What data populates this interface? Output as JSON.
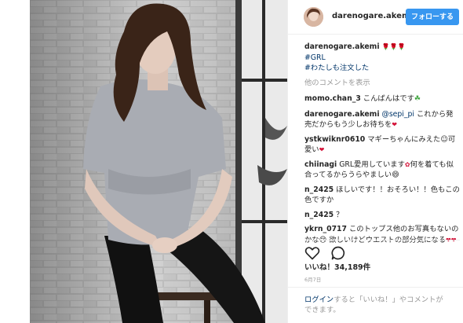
{
  "post": {
    "username": "darenogare.akemi",
    "follow_label": "フォローする"
  },
  "caption": {
    "username": "darenogare.akemi",
    "flowers": "🌹🌹🌹",
    "tag1": "#GRL",
    "tag2": "#わたしも注文した"
  },
  "more_comments": "他のコメントを表示",
  "comments": [
    {
      "user": "momo.chan_3",
      "text": "こんばんはです",
      "emoji": "☘"
    },
    {
      "user": "darenogare.akemi",
      "mention": "@sepi_pi",
      "text": "これから発売だからもう少しお待ちを",
      "emoji": "❤"
    },
    {
      "user": "ystkwiknr0610",
      "text": "マギーちゃんにみえた☺可愛い",
      "emoji": "❤"
    },
    {
      "user": "chiinagi",
      "text": "GRL愛用しています",
      "emoji_mid": "✿",
      "text2": "何を着ても似合ってるからうらやましい",
      "emoji_end": "😄"
    },
    {
      "user": "n_2425",
      "text": "ほしいです！！おそろい！！色もこの色ですか"
    },
    {
      "user": "n_2425",
      "text": "？"
    },
    {
      "user": "ykrn_0717",
      "text": "このトップス他のお写真もないのかな😢 欲しいけどウエストの部分気になる",
      "emoji": "❤❤"
    }
  ],
  "likes": "いいね！34,189件",
  "date": "6月7日",
  "footer": {
    "login": "ログイン",
    "rest": "すると「いいね！」やコメントができます。"
  },
  "icons": {
    "like": "heart-outline-icon",
    "comment": "speech-bubble-icon"
  },
  "colors": {
    "follow_button": "#3897f0",
    "link": "#003569",
    "muted": "#999999"
  }
}
